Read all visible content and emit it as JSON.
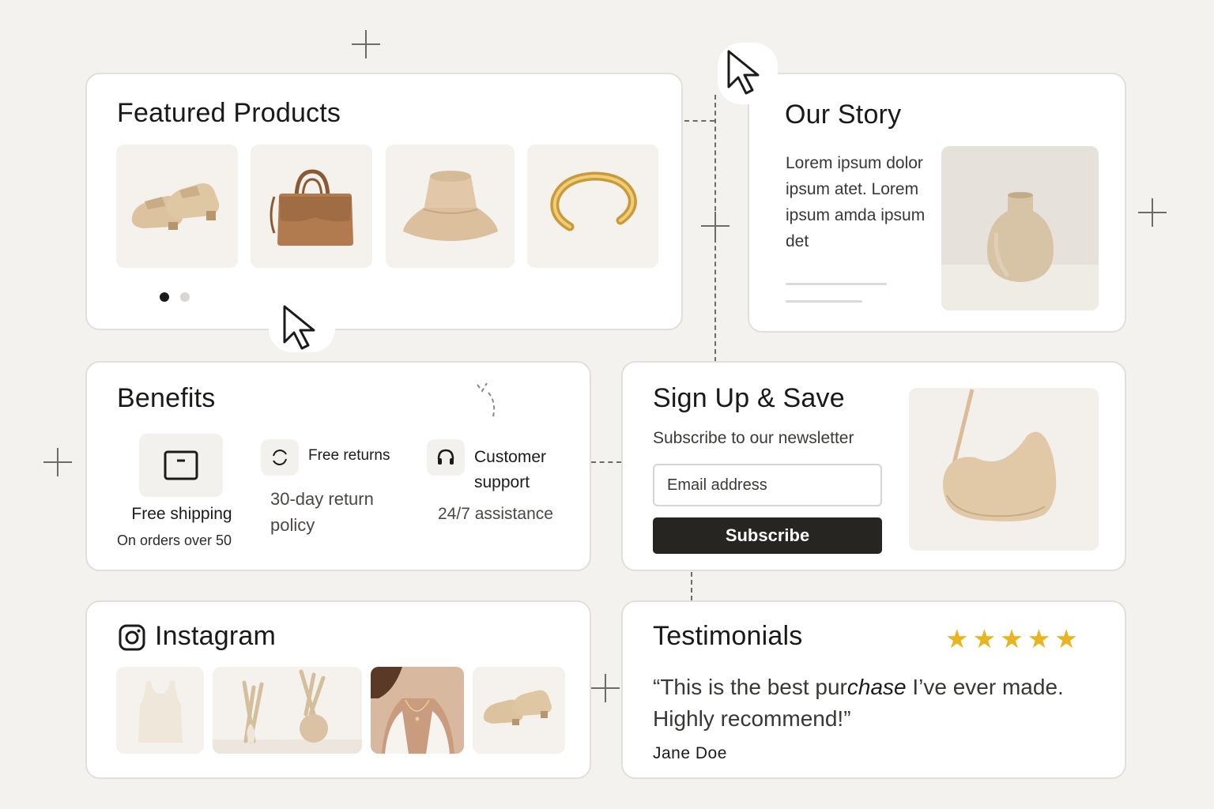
{
  "featured": {
    "title": "Featured Products",
    "products": [
      {
        "icon": "loafers-icon"
      },
      {
        "icon": "handbag-icon"
      },
      {
        "icon": "bucket-hat-icon"
      },
      {
        "icon": "gold-bracelet-icon"
      }
    ],
    "carousel": {
      "pages": 2,
      "active": 1
    }
  },
  "story": {
    "title": "Our Story",
    "text": "Lorem ipsum dolor ipsum atet. Lorem ipsum amda ipsum det",
    "image": "vase-icon"
  },
  "benefits": {
    "title": "Benefits",
    "items": [
      {
        "icon": "shipping-box-icon",
        "label": "Free shipping",
        "sub": "On orders over 50"
      },
      {
        "icon": "refresh-icon",
        "label": "Free returns",
        "sub": "30-day return policy"
      },
      {
        "icon": "headset-icon",
        "label": "Customer support",
        "sub": "24/7 assistance"
      }
    ]
  },
  "signup": {
    "title": "Sign Up & Save",
    "subtitle": "Subscribe to our newsletter",
    "email_placeholder": "Email address",
    "button_label": "Subscribe",
    "image": "shoulder-bag-icon"
  },
  "instagram": {
    "title": "Instagram",
    "icon": "instagram-icon",
    "photos": [
      "tank-top-icon",
      "pampas-vases-icon",
      "necklace-portrait-icon",
      "loafers-icon"
    ]
  },
  "testimonials": {
    "title": "Testimonials",
    "rating": 5,
    "quote_before": "“This is the best pur",
    "quote_em": "chase",
    "quote_after": " I’ve ever made. Highly recommend!”",
    "author": "Jane Doe"
  },
  "colors": {
    "background": "#f4f2ef",
    "accent": "#262522",
    "star": "#e8b520",
    "tan": "#d9bf9c"
  }
}
